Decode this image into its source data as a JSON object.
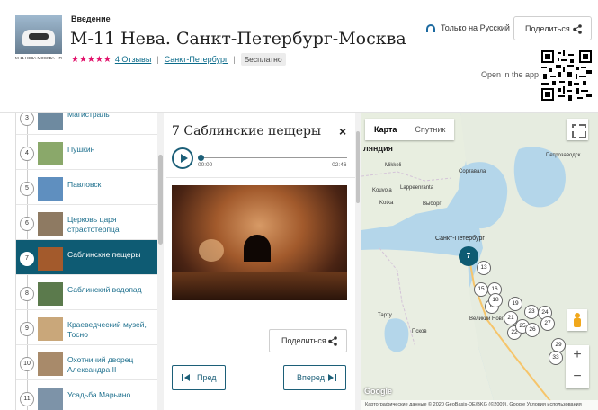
{
  "header": {
    "cover_tag": "М-11 НЕВА МОСКВА – ПЕТЕ",
    "subtitle": "Введение",
    "title": "М-11 Нева. Санкт-Петербург-Москва",
    "stars": "★★★★★",
    "reviews_link": "4 Отзывы",
    "city_link": "Санкт-Петербург",
    "price_badge": "Бесплатно",
    "language_note": "Только на Русский",
    "share_label": "Поделиться",
    "open_app_label": "Open in the app"
  },
  "stops": [
    {
      "num": "3",
      "label": "Магистраль",
      "thumb": "#6e8aa0"
    },
    {
      "num": "4",
      "label": "Пушкин",
      "thumb": "#8aa86a"
    },
    {
      "num": "5",
      "label": "Павловск",
      "thumb": "#5f8fbf"
    },
    {
      "num": "6",
      "label": "Церковь царя страстотерпца",
      "thumb": "#8e7a62"
    },
    {
      "num": "7",
      "label": "Саблинские пещеры",
      "thumb": "#a35a2c"
    },
    {
      "num": "8",
      "label": "Саблинский водопад",
      "thumb": "#5b7a4c"
    },
    {
      "num": "9",
      "label": "Краеведческий музей, Тосно",
      "thumb": "#c9a77a"
    },
    {
      "num": "10",
      "label": "Охотничий дворец Александра II",
      "thumb": "#a88a6a"
    },
    {
      "num": "11",
      "label": "Усадьба Марьино",
      "thumb": "#7d93a8"
    }
  ],
  "detail": {
    "title": "7 Саблинские пещеры",
    "close_label": "×",
    "time_current": "00:00",
    "time_remaining": "-02:46",
    "share_label": "Поделиться",
    "prev_label": "Пред",
    "next_label": "Вперед"
  },
  "map": {
    "tabs": [
      "Карта",
      "Спутник"
    ],
    "labels": {
      "finland": "ляндия",
      "mikkeli": "Mikkeli",
      "lappeenranta": "Lappeenranta",
      "kouvola": "Kouvola",
      "kotka": "Kotka",
      "vyborg": "Выборг",
      "sortavala": "Сортавала",
      "petrozavodsk": "Петрозаводск",
      "spb": "Санкт-Петербург",
      "tartu": "Тарту",
      "pskov": "Псков",
      "veliky": "Великий Новгород"
    },
    "pins": [
      "7",
      "13",
      "15",
      "16",
      "17",
      "18",
      "19",
      "21",
      "22",
      "23",
      "24",
      "25",
      "26",
      "27",
      "29",
      "33"
    ],
    "zoom_in": "+",
    "zoom_out": "−",
    "google": "Google",
    "attribution": "Картографические данные © 2020 GeoBasis-DE/BKG (©2009), Google  Условия использования"
  },
  "colors": {
    "accent": "#0e5b73",
    "stars": "#e2126b",
    "link": "#0b6b8a",
    "water": "#b4d6ea"
  }
}
